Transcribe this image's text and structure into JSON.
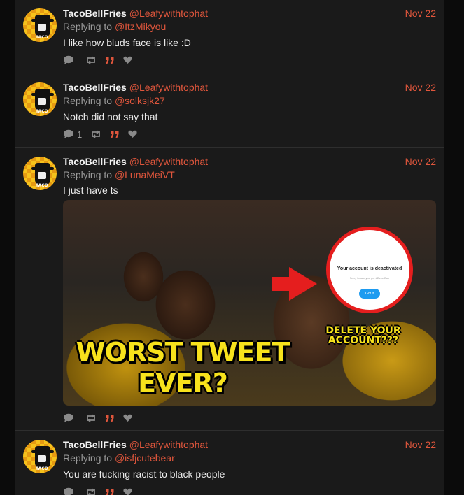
{
  "tweets": [
    {
      "name": "TacoBellFries",
      "handle": "@Leafywithtophat",
      "date": "Nov 22",
      "replying_label": "Replying to",
      "replying_to": "@ItzMikyou",
      "text": "I like how bluds face is like :D",
      "reply_count": ""
    },
    {
      "name": "TacoBellFries",
      "handle": "@Leafywithtophat",
      "date": "Nov 22",
      "replying_label": "Replying to",
      "replying_to": "@solksjk27",
      "text": "Notch did not say that",
      "reply_count": "1"
    },
    {
      "name": "TacoBellFries",
      "handle": "@Leafywithtophat",
      "date": "Nov 22",
      "replying_label": "Replying to",
      "replying_to": "@LunaMeiVT",
      "text": "I just have ts",
      "reply_count": "",
      "media": {
        "caption_main": "WORST TWEET EVER?",
        "caption_side": "DELETE YOUR ACCOUNT???",
        "popup_title": "Your account is deactivated",
        "popup_sub": "Sorry to see you go. #DevelBun",
        "popup_button": "Got it"
      }
    },
    {
      "name": "TacoBellFries",
      "handle": "@Leafywithtophat",
      "date": "Nov 22",
      "replying_label": "Replying to",
      "replying_to": "@isfjcutebear",
      "text": "You are fucking racist to black people",
      "reply_count": ""
    }
  ],
  "icons": {
    "reply": "comment-icon",
    "retweet": "retweet-icon",
    "quote": "quote-icon",
    "like": "heart-icon"
  },
  "avatar_tag": "TACO",
  "colors": {
    "accent": "#e0563c",
    "background": "#1a1a1a",
    "page": "#0b0b0b",
    "muted": "#8a8a8a"
  }
}
